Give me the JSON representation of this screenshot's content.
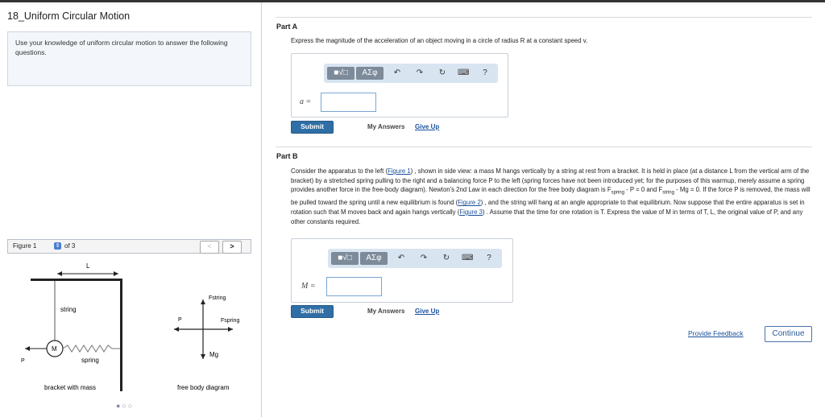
{
  "page": {
    "title": "18_Uniform Circular Motion",
    "intro": "Use your knowledge of uniform circular motion to answer the following questions."
  },
  "figure": {
    "label": "Figure 1",
    "of_text": "of 3",
    "prev": "<",
    "next": ">",
    "labels": {
      "L": "L",
      "string": "string",
      "M": "M",
      "spring": "spring",
      "P": "P",
      "bracket": "bracket with mass",
      "fstring": "Fstring",
      "fspring": "Fspring",
      "P2": "P",
      "Mg": "Mg",
      "fbd": "free body diagram"
    },
    "pager_dots": "●○○"
  },
  "partA": {
    "heading": "Part A",
    "question": "Express the magnitude of the acceleration of an object moving in a circle of radius R at a constant speed v.",
    "var": "a =",
    "submit": "Submit",
    "my_answers": "My Answers",
    "give_up": "Give Up"
  },
  "partB": {
    "heading": "Part B",
    "text_1": "Consider the apparatus to the left (",
    "fig1": "Figure 1",
    "text_2": ") , shown in side view: a mass M hangs vertically by a string at rest from a bracket. It is held in place (at a distance L from the vertical arm of the bracket) by a stretched spring pulling to the right and a balancing force P to the left (spring forces have not been introduced yet; for the purposes of this warmup, merely assume a spring provides another force in the free-body diagram). Newton's 2nd Law in each direction for the free body diagram is F",
    "sub_spring": "spring",
    "text_3": " - P = 0 and F",
    "sub_string": "string",
    "text_4": " - Mg = 0. If the force P is removed, the mass will be pulled toward the spring until a new equilibrium is found (",
    "fig2": "Figure 2",
    "text_5": ") , and the string will hang at an angle appropriate to that equilibrium. Now suppose that the entire apparatus is set in rotation such that M moves back and again hangs vertically (",
    "fig3": "Figure 3",
    "text_6": ") . Assume that the time for one rotation is T. Express the value of M in terms of T, L, the original value of P, and any other constants required.",
    "var": "M =",
    "submit": "Submit",
    "my_answers": "My Answers",
    "give_up": "Give Up"
  },
  "toolbar": {
    "template": "■√□",
    "greek": "ΑΣφ",
    "undo": "↶",
    "redo": "↷",
    "reset": "↻",
    "keyboard": "⌨",
    "help": "?"
  },
  "footer": {
    "feedback": "Provide Feedback",
    "continue": "Continue"
  },
  "colors": {
    "accent": "#2f6fa6",
    "toolbar_bg": "#d9e4f1",
    "link": "#1a4f9c"
  }
}
